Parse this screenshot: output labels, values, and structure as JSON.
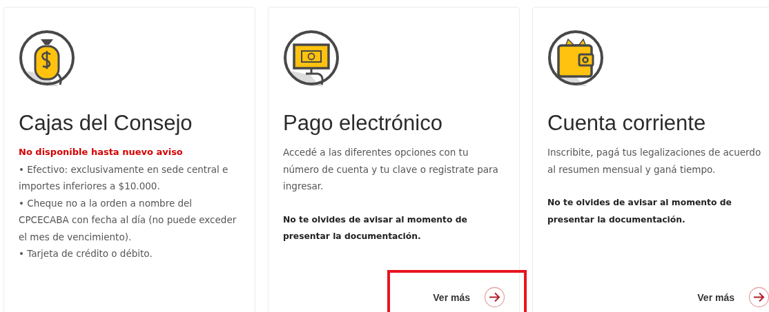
{
  "cards": [
    {
      "kind": "money-bag",
      "title": "Cajas del Consejo",
      "paragraphs": [
        {
          "kind": "alert",
          "text": "No disponible hasta nuevo aviso"
        },
        {
          "kind": "normal",
          "text": "• Efectivo: exclusivamente en sede central e importes inferiores a $10.000."
        },
        {
          "kind": "normal",
          "text": "• Cheque no a la orden a nombre del CPCECABA con fecha al día (no puede exceder el mes de vencimiento)."
        },
        {
          "kind": "normal",
          "text": "• Tarjeta de crédito o débito."
        }
      ],
      "highlighted": false
    },
    {
      "kind": "monitor",
      "title": "Pago electrónico",
      "paragraphs": [
        {
          "kind": "normal",
          "text": "Accedé a las diferentes opciones con tu número de cuenta y tu clave o registrate para ingresar."
        },
        {
          "kind": "bold",
          "text": "No te olvides de avisar al momento de presentar la documentación."
        }
      ],
      "link": "Ver más",
      "highlighted": true
    },
    {
      "kind": "wallet",
      "title": "Cuenta corriente",
      "paragraphs": [
        {
          "kind": "normal",
          "text": "Inscribite, pagá tus legalizaciones de acuerdo al resumen mensual y ganá tiempo."
        },
        {
          "kind": "bold",
          "text": "No te olvides de avisar al momento de presentar la documentación."
        }
      ],
      "link": "Ver más",
      "highlighted": false
    }
  ]
}
